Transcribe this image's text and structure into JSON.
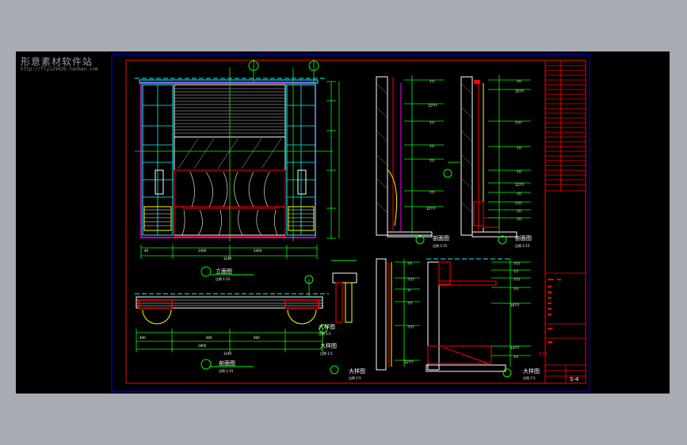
{
  "watermark": {
    "title": "形意素材软件站",
    "url": "http://fly129426.taobao.com"
  },
  "elevation": {
    "title": "立面图",
    "scale": "比例 1:15"
  },
  "plan": {
    "title": "剖面图",
    "scale": "比例 1:15"
  },
  "section1": {
    "title": "剖面图",
    "scale": "比例 1:15"
  },
  "section2": {
    "title": "剖面图",
    "scale": "比例 1:15"
  },
  "detail1": {
    "title": "大样图",
    "scale": "比例 1:5"
  },
  "detail2": {
    "title": "大样图",
    "scale": "比例 1:5"
  },
  "detail3": {
    "title": "大样图",
    "scale": "比例 1:5"
  },
  "detail4": {
    "title": "大样图",
    "scale": "比例 1:5"
  },
  "title_block": {
    "project": "???",
    "sheet": "S-4"
  },
  "colors": {
    "frame": "#0000ff",
    "border": "#ff0000",
    "line_green": "#00ff00",
    "line_cyan": "#00ffff",
    "line_magenta": "#ff00ff",
    "line_yellow": "#ffff00",
    "line_white": "#ffffff"
  }
}
